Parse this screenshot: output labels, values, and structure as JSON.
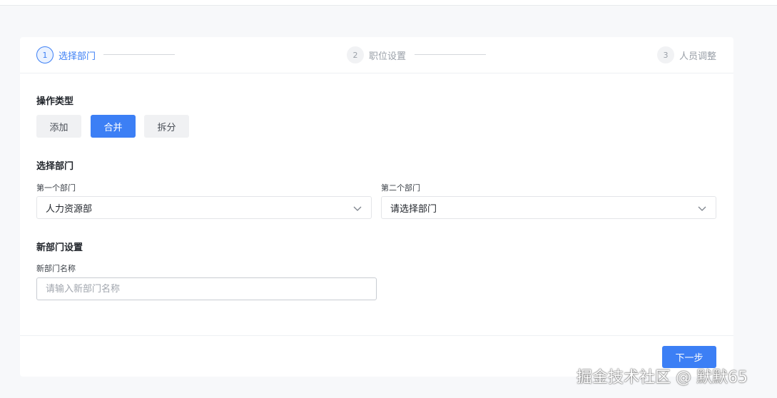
{
  "steps": [
    {
      "number": "1",
      "label": "选择部门",
      "state": "active"
    },
    {
      "number": "2",
      "label": "职位设置",
      "state": "idle"
    },
    {
      "number": "3",
      "label": "人员调整",
      "state": "idle"
    }
  ],
  "operation": {
    "title": "操作类型",
    "options": [
      "添加",
      "合并",
      "拆分"
    ],
    "selected": "合并"
  },
  "select_department": {
    "title": "选择部门",
    "first": {
      "label": "第一个部门",
      "value": "人力资源部"
    },
    "second": {
      "label": "第二个部门",
      "value": "请选择部门"
    }
  },
  "new_department": {
    "title": "新部门设置",
    "name_label": "新部门名称",
    "name_placeholder": "请输入新部门名称",
    "name_value": ""
  },
  "footer": {
    "next_label": "下一步"
  },
  "watermark": "掘金技术社区 @ 默默65",
  "colors": {
    "accent": "#3c7ff5",
    "background": "#f7f8fa"
  },
  "icons": {
    "select_arrow": "chevron-down-icon"
  }
}
